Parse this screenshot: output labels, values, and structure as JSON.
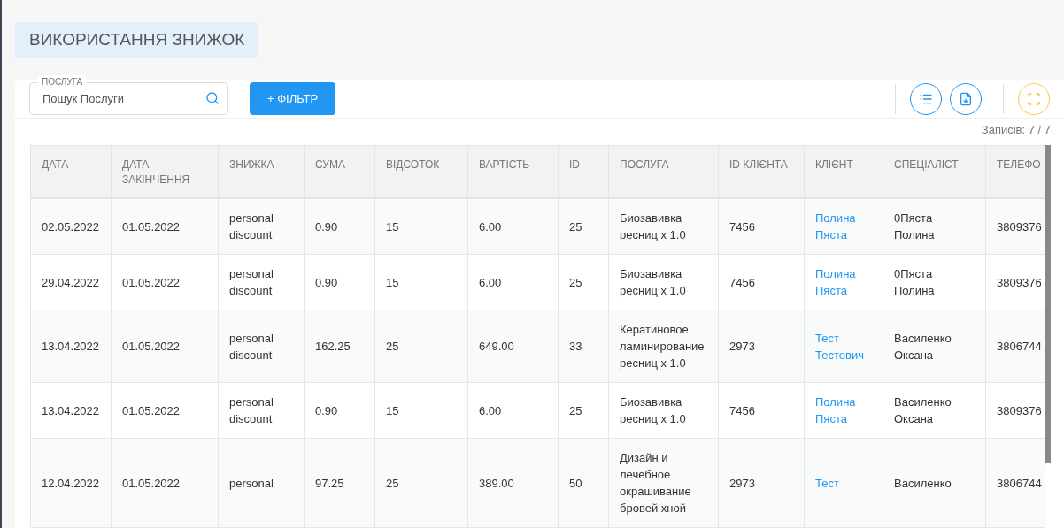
{
  "title": "ВИКОРИСТАННЯ ЗНИЖОК",
  "search": {
    "label": "ПОСЛУГА",
    "placeholder": "Пошук Послуги"
  },
  "filter_button": "+ ФІЛЬТР",
  "records": "Записів: 7 / 7",
  "table": {
    "columns": [
      {
        "label": "ДАТА",
        "kind": "text"
      },
      {
        "label": "ДАТА ЗАКІНЧЕННЯ",
        "kind": "text"
      },
      {
        "label": "ЗНИЖКА",
        "kind": "text"
      },
      {
        "label": "СУМА",
        "kind": "text"
      },
      {
        "label": "ВІДСОТОК",
        "kind": "text"
      },
      {
        "label": "ВАРТІСТЬ",
        "kind": "text"
      },
      {
        "label": "ID",
        "kind": "text"
      },
      {
        "label": "ПОСЛУГА",
        "kind": "text"
      },
      {
        "label": "ID КЛІЄНТА",
        "kind": "text"
      },
      {
        "label": "КЛІЄНТ",
        "kind": "link"
      },
      {
        "label": "СПЕЦІАЛІСТ",
        "kind": "text"
      },
      {
        "label": "ТЕЛЕФО",
        "kind": "text"
      }
    ],
    "rows": [
      [
        "02.05.2022",
        "01.05.2022",
        "personal discount",
        "0.90",
        "15",
        "6.00",
        "25",
        "Биозавивка ресниц х 1.0",
        "7456",
        "Полина Пяста",
        "0Пяста Полина",
        "3809376"
      ],
      [
        "29.04.2022",
        "01.05.2022",
        "personal discount",
        "0.90",
        "15",
        "6.00",
        "25",
        "Биозавивка ресниц х 1.0",
        "7456",
        "Полина Пяста",
        "0Пяста Полина",
        "3809376"
      ],
      [
        "13.04.2022",
        "01.05.2022",
        "personal discount",
        "162.25",
        "25",
        "649.00",
        "33",
        "Кератиновое ламинирование ресниц х 1.0",
        "2973",
        "Тест Тестович",
        "Василенко Оксана",
        "3806744"
      ],
      [
        "13.04.2022",
        "01.05.2022",
        "personal discount",
        "0.90",
        "15",
        "6.00",
        "25",
        "Биозавивка ресниц х 1.0",
        "7456",
        "Полина Пяста",
        "Василенко Оксана",
        "3809376"
      ],
      [
        "12.04.2022",
        "01.05.2022",
        "personal",
        "97.25",
        "25",
        "389.00",
        "50",
        "Дизайн и лечебное окрашивание бровей хной",
        "2973",
        "Тест",
        "Василенко",
        "3806744"
      ]
    ]
  }
}
